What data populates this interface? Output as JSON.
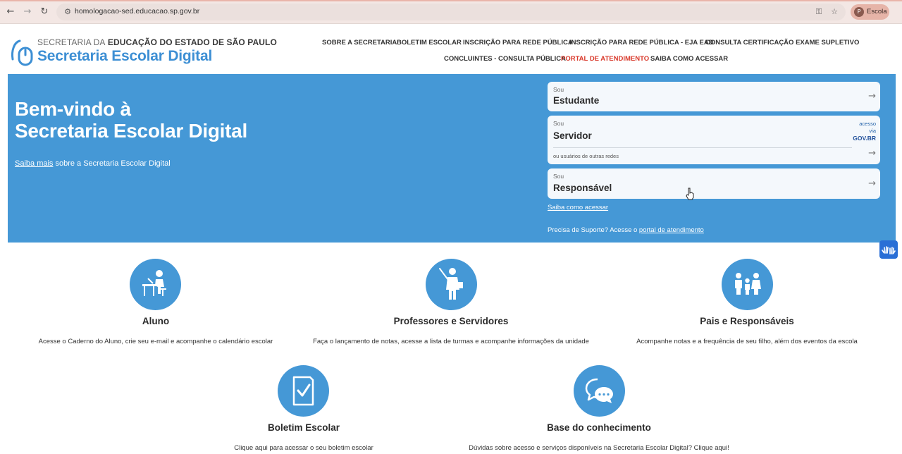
{
  "browser": {
    "url": "homologacao-sed.educacao.sp.gov.br",
    "profile_initial": "P",
    "profile_name": "Escola"
  },
  "header": {
    "org_prefix": "SECRETARIA DA",
    "org_name": "EDUCAÇÃO DO ESTADO DE SÃO PAULO",
    "brand": "Secretaria Escolar Digital"
  },
  "menu": [
    {
      "label": "SOBRE A SECRETARIA"
    },
    {
      "label": "BOLETIM ESCOLAR"
    },
    {
      "label": "INSCRIÇÃO PARA REDE PÚBLICA"
    },
    {
      "label": "INSCRIÇÃO PARA REDE PÚBLICA - EJA EAD"
    },
    {
      "label": "CONSULTA CERTIFICAÇÃO EXAME SUPLETIVO"
    },
    {
      "label": "CONCLUINTES - CONSULTA PÚBLICA"
    },
    {
      "label": "PORTAL DE ATENDIMENTO"
    },
    {
      "label": "SAIBA COMO ACESSAR"
    }
  ],
  "hero": {
    "title_line1": "Bem-vindo à",
    "title_line2": "Secretaria Escolar Digital",
    "saiba_mais": "Saiba mais",
    "sub_rest": " sobre a Secretaria Escolar Digital",
    "access_link": "Saiba como acessar",
    "support_prefix": "Precisa de Suporte? Acesse o ",
    "support_link": "portal de atendimento"
  },
  "cards": [
    {
      "sou": "Sou",
      "who": "Estudante"
    },
    {
      "sou": "Sou",
      "who": "Servidor",
      "gov_line1": "acesso",
      "gov_line2": "via",
      "gov_brand": "GOV.BR",
      "other": "ou usuários de outras redes"
    },
    {
      "sou": "Sou",
      "who": "Responsável"
    }
  ],
  "features": [
    {
      "title": "Aluno",
      "desc": "Acesse o Caderno do Aluno, crie seu e-mail e acompanhe o calendário escolar",
      "icon": "student-desk-icon"
    },
    {
      "title": "Professores e Servidores",
      "desc": "Faça o lançamento de notas, acesse a lista de turmas e acompanhe informações da unidade",
      "icon": "teacher-icon"
    },
    {
      "title": "Pais e Responsáveis",
      "desc": "Acompanhe notas e a frequência de seu filho, além dos eventos da escola",
      "icon": "family-icon"
    },
    {
      "title": "Boletim Escolar",
      "desc": "Clique aqui para acessar o seu boletim escolar",
      "icon": "report-card-icon"
    },
    {
      "title": "Base do conhecimento",
      "desc": "Dúvidas sobre acesso e serviços disponíveis na Secretaria Escolar Digital? Clique aqui!",
      "icon": "chat-bubbles-icon"
    }
  ],
  "colors": {
    "accent": "#4598d6",
    "brand_text": "#3d8fd4",
    "highlight_menu": "#d9392b"
  }
}
